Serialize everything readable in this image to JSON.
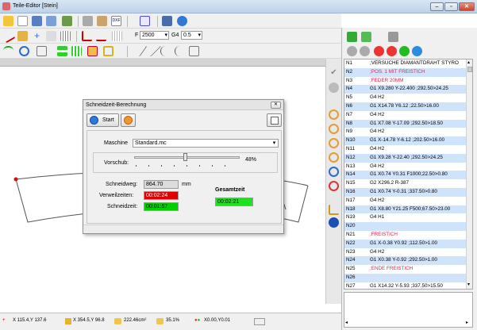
{
  "window": {
    "title": "Teile-Editor [Stein]",
    "minimize": "–",
    "maximize": "▫",
    "close": "✕"
  },
  "toolbar": {
    "feed_label": "F",
    "feed_value": "2500",
    "g_label": "G4",
    "g_value": "0.5"
  },
  "icons": [
    "open-icon",
    "new-icon",
    "save-icon",
    "save-as-icon",
    "import-icon",
    "print-icon",
    "clipboard-icon",
    "dxf-icon",
    "sequence-icon",
    "machine-icon",
    "timer-icon",
    "line-icon",
    "pencil-icon",
    "cross-icon",
    "magic-icon",
    "grid-icon",
    "axis-icon",
    "path-icon",
    "dotted-grid-icon",
    "contour-icon",
    "rotate-icon",
    "mirror-icon",
    "align-icon",
    "bars-icon",
    "box-icon",
    "frame-icon",
    "slash-icon",
    "slope-icon",
    "arc-icon",
    "xy-icon",
    "g4-icon"
  ],
  "dialog": {
    "title": "Schneidzeit-Berechnung",
    "close": "✕",
    "start_label": "Start",
    "machine_label": "Maschine",
    "machine_value": "Standard.mc",
    "feed_label": "Vorschub:",
    "feed_percent": "48%",
    "feed_fraction": 0.48,
    "cut_path_label": "Schneidweg:",
    "cut_path_value": "864.70",
    "cut_path_unit": "mm",
    "dwell_label": "Verweilzeiten:",
    "dwell_value": "00:02:24",
    "cut_time_label": "Schneidzeit:",
    "cut_time_value": "00:01:57",
    "total_label": "Gesamtzeit",
    "total_value": "00:02:21"
  },
  "nc_lines": [
    {
      "n": "N1",
      "t": ";VERSUCHE DIAMANTDRAHT  STYRO"
    },
    {
      "n": "N2",
      "t": ";POS. 1 MIT FREISTICH"
    },
    {
      "n": "N3",
      "t": ";FEDER 20MM"
    },
    {
      "n": "N4",
      "t": "G1 X9.280 Y-22.400 ;292.50>24.25"
    },
    {
      "n": "N5",
      "t": "G4 H2"
    },
    {
      "n": "N6",
      "t": "G1 X14.78 Y6.12 ;22.50>16.00"
    },
    {
      "n": "N7",
      "t": "G4 H2"
    },
    {
      "n": "N8",
      "t": "G1 X7.08 Y-17.09 ;292.50>18.50"
    },
    {
      "n": "N9",
      "t": "G4 H2"
    },
    {
      "n": "N10",
      "t": "G1 X-14.78 Y-6.12 ;202.50>16.00"
    },
    {
      "n": "N11",
      "t": "G4 H2"
    },
    {
      "n": "N12",
      "t": "G1 X9.28 Y-22.40 ;292.50>24.25"
    },
    {
      "n": "N13",
      "t": "G4 H2"
    },
    {
      "n": "N14",
      "t": "G1 X0.74 Y0.31 F1000;22.50>0.80"
    },
    {
      "n": "N15",
      "t": "G2 X296.2 R-387"
    },
    {
      "n": "N16",
      "t": "G1 X0.74 Y-0.31 ;337.50>0.80"
    },
    {
      "n": "N17",
      "t": "G4 H2"
    },
    {
      "n": "N18",
      "t": "G1 X8.80 Y21.25 F500;67.50>23.00"
    },
    {
      "n": "N19",
      "t": "G4 H1"
    },
    {
      "n": "N20",
      "t": ""
    },
    {
      "n": "N21",
      "t": ";FREISTICH"
    },
    {
      "n": "N22",
      "t": "G1 X-0.38 Y0.92 ;112.50>1.00"
    },
    {
      "n": "N23",
      "t": "G4 H2"
    },
    {
      "n": "N24",
      "t": "G1 X0.38 Y-0.92 ;292.50>1.00"
    },
    {
      "n": "N25",
      "t": ";ENDE FREISTICH"
    },
    {
      "n": "N26",
      "t": ""
    },
    {
      "n": "N27",
      "t": "G1 X14.32 Y-5.93 ;337.50>15.50"
    }
  ],
  "status": {
    "pos1": "X 115.4,Y 137.6",
    "pos2": "X 354.5,Y  96.8",
    "area": "222.46cm²",
    "percent": "35.1%",
    "origin": "X0.00,Y0.01"
  },
  "colors": {
    "accent": "#e2264a",
    "dwell_bg": "#e00000",
    "time_bg": "#00d000",
    "total_bg": "#21e021"
  }
}
